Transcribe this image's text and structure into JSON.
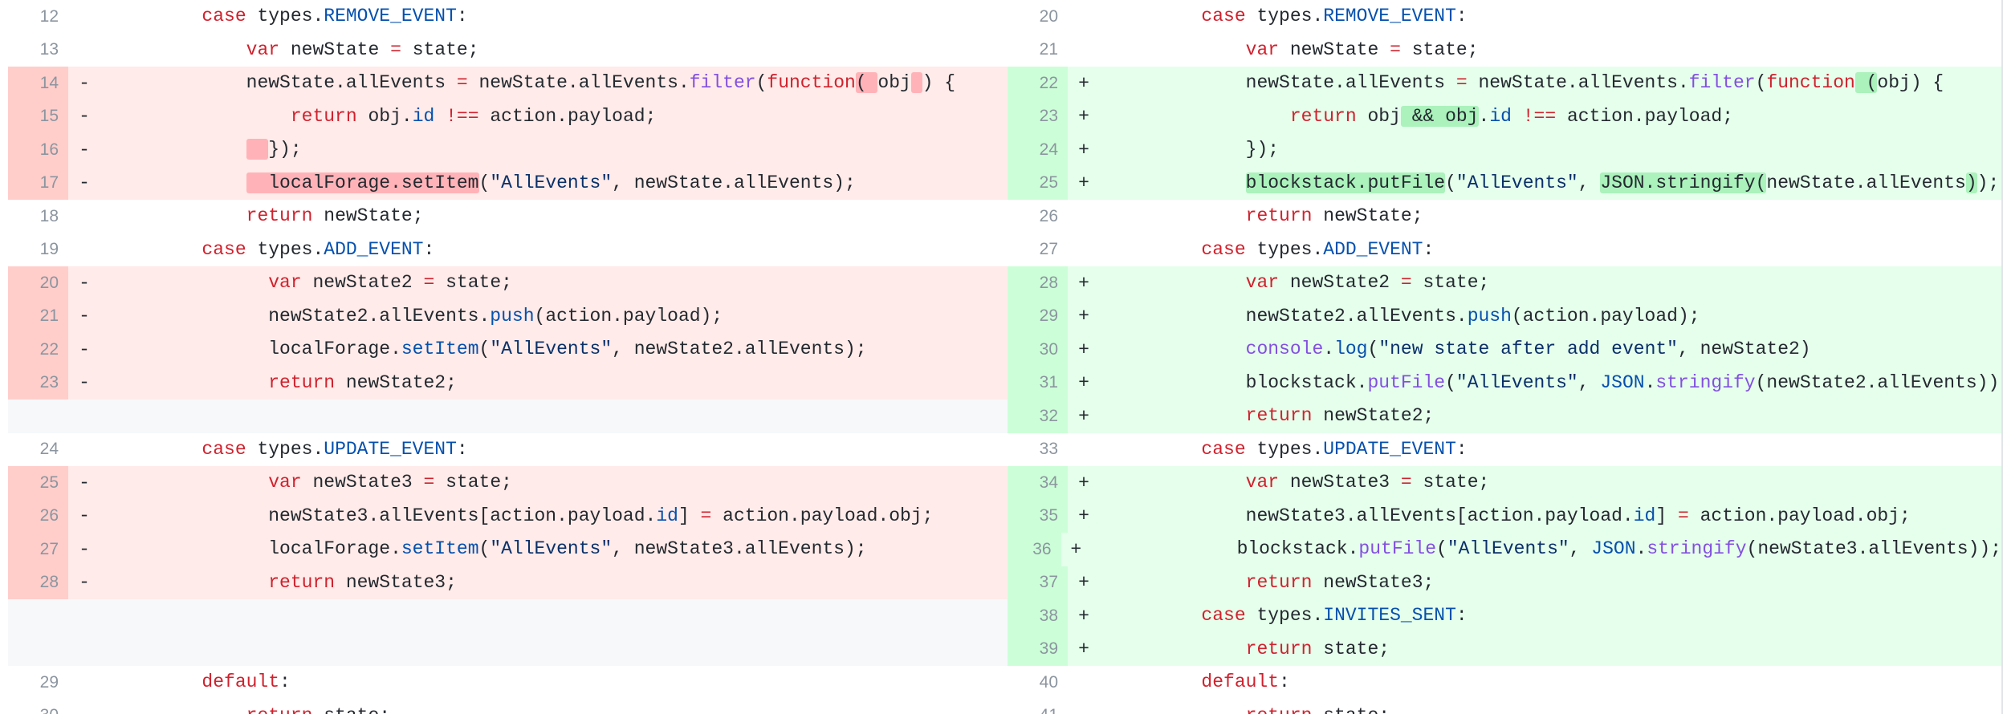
{
  "colors": {
    "keyword": "#cf222e",
    "constant": "#0550ae",
    "function": "#8250df",
    "string": "#0a3069",
    "deleted_bg": "#ffebe9",
    "deleted_gutter": "#ffcecb",
    "deleted_highlight": "#ffb3b8",
    "added_bg": "#e6ffec",
    "added_gutter": "#ccffd8",
    "added_highlight": "#abf2bc",
    "line_number": "#8c959f"
  },
  "left": [
    {
      "type": "ctx",
      "num": "12",
      "marker": "",
      "indent": 2,
      "tokens": [
        [
          "k",
          "case"
        ],
        [
          "p",
          " types."
        ],
        [
          "c",
          "REMOVE_EVENT"
        ],
        [
          "p",
          ":"
        ]
      ]
    },
    {
      "type": "ctx",
      "num": "13",
      "marker": "",
      "indent": 3,
      "tokens": [
        [
          "k",
          "var"
        ],
        [
          "p",
          " newState "
        ],
        [
          "k",
          "="
        ],
        [
          "p",
          " state;"
        ]
      ]
    },
    {
      "type": "del",
      "num": "14",
      "marker": "-",
      "indent": 3,
      "tokens": [
        [
          "p",
          "newState.allEvents "
        ],
        [
          "k",
          "="
        ],
        [
          "p",
          " newState.allEvents."
        ],
        [
          "f",
          "filter"
        ],
        [
          "p",
          "("
        ],
        [
          "k",
          "function"
        ],
        [
          "hl",
          "( "
        ],
        [
          "p",
          "obj"
        ],
        [
          "hl",
          " "
        ],
        [
          "p",
          ") {"
        ]
      ]
    },
    {
      "type": "del",
      "num": "15",
      "marker": "-",
      "indent": 4,
      "tokens": [
        [
          "k",
          "return"
        ],
        [
          "p",
          " obj."
        ],
        [
          "c",
          "id"
        ],
        [
          "p",
          " "
        ],
        [
          "k",
          "!=="
        ],
        [
          "p",
          " action.payload;"
        ]
      ]
    },
    {
      "type": "del",
      "num": "16",
      "marker": "-",
      "indent": 3,
      "tokens": [
        [
          "hl",
          "  "
        ],
        [
          "p",
          "});"
        ]
      ]
    },
    {
      "type": "del",
      "num": "17",
      "marker": "-",
      "indent": 3,
      "tokens": [
        [
          "hl",
          "  localForage.setItem"
        ],
        [
          "p",
          "("
        ],
        [
          "s",
          "\"AllEvents\""
        ],
        [
          "p",
          ", newState.allEvents);"
        ]
      ]
    },
    {
      "type": "ctx",
      "num": "18",
      "marker": "",
      "indent": 3,
      "tokens": [
        [
          "k",
          "return"
        ],
        [
          "p",
          " newState;"
        ]
      ]
    },
    {
      "type": "ctx",
      "num": "19",
      "marker": "",
      "indent": 2,
      "tokens": [
        [
          "k",
          "case"
        ],
        [
          "p",
          " types."
        ],
        [
          "c",
          "ADD_EVENT"
        ],
        [
          "p",
          ":"
        ]
      ]
    },
    {
      "type": "del",
      "num": "20",
      "marker": "-",
      "indent": 3,
      "tokens": [
        [
          "p",
          "  "
        ],
        [
          "k",
          "var"
        ],
        [
          "p",
          " newState2 "
        ],
        [
          "k",
          "="
        ],
        [
          "p",
          " state;"
        ]
      ]
    },
    {
      "type": "del",
      "num": "21",
      "marker": "-",
      "indent": 3,
      "tokens": [
        [
          "p",
          "  newState2.allEvents."
        ],
        [
          "c",
          "push"
        ],
        [
          "p",
          "(action.payload);"
        ]
      ]
    },
    {
      "type": "del",
      "num": "22",
      "marker": "-",
      "indent": 3,
      "tokens": [
        [
          "p",
          "  localForage."
        ],
        [
          "c",
          "setItem"
        ],
        [
          "p",
          "("
        ],
        [
          "s",
          "\"AllEvents\""
        ],
        [
          "p",
          ", newState2.allEvents);"
        ]
      ]
    },
    {
      "type": "del",
      "num": "23",
      "marker": "-",
      "indent": 3,
      "tokens": [
        [
          "p",
          "  "
        ],
        [
          "k",
          "return"
        ],
        [
          "p",
          " newState2;"
        ]
      ]
    },
    {
      "type": "empty",
      "num": "",
      "marker": "",
      "indent": 0,
      "tokens": []
    },
    {
      "type": "ctx",
      "num": "24",
      "marker": "",
      "indent": 2,
      "tokens": [
        [
          "k",
          "case"
        ],
        [
          "p",
          " types."
        ],
        [
          "c",
          "UPDATE_EVENT"
        ],
        [
          "p",
          ":"
        ]
      ]
    },
    {
      "type": "del",
      "num": "25",
      "marker": "-",
      "indent": 3,
      "tokens": [
        [
          "p",
          "  "
        ],
        [
          "k",
          "var"
        ],
        [
          "p",
          " newState3 "
        ],
        [
          "k",
          "="
        ],
        [
          "p",
          " state;"
        ]
      ]
    },
    {
      "type": "del",
      "num": "26",
      "marker": "-",
      "indent": 3,
      "tokens": [
        [
          "p",
          "  newState3.allEvents[action.payload."
        ],
        [
          "c",
          "id"
        ],
        [
          "p",
          "] "
        ],
        [
          "k",
          "="
        ],
        [
          "p",
          " action.payload.obj;"
        ]
      ]
    },
    {
      "type": "del",
      "num": "27",
      "marker": "-",
      "indent": 3,
      "tokens": [
        [
          "p",
          "  localForage."
        ],
        [
          "c",
          "setItem"
        ],
        [
          "p",
          "("
        ],
        [
          "s",
          "\"AllEvents\""
        ],
        [
          "p",
          ", newState3.allEvents);"
        ]
      ]
    },
    {
      "type": "del",
      "num": "28",
      "marker": "-",
      "indent": 3,
      "tokens": [
        [
          "p",
          "  "
        ],
        [
          "k",
          "return"
        ],
        [
          "p",
          " newState3;"
        ]
      ]
    },
    {
      "type": "empty",
      "num": "",
      "marker": "",
      "indent": 0,
      "tokens": []
    },
    {
      "type": "empty",
      "num": "",
      "marker": "",
      "indent": 0,
      "tokens": []
    },
    {
      "type": "ctx",
      "num": "29",
      "marker": "",
      "indent": 2,
      "tokens": [
        [
          "k",
          "default"
        ],
        [
          "p",
          ":"
        ]
      ]
    },
    {
      "type": "ctx",
      "num": "30",
      "marker": "",
      "indent": 3,
      "tokens": [
        [
          "k",
          "return"
        ],
        [
          "p",
          " state;"
        ]
      ]
    }
  ],
  "right": [
    {
      "type": "ctx",
      "num": "20",
      "marker": "",
      "indent": 2,
      "tokens": [
        [
          "k",
          "case"
        ],
        [
          "p",
          " types."
        ],
        [
          "c",
          "REMOVE_EVENT"
        ],
        [
          "p",
          ":"
        ]
      ]
    },
    {
      "type": "ctx",
      "num": "21",
      "marker": "",
      "indent": 3,
      "tokens": [
        [
          "k",
          "var"
        ],
        [
          "p",
          " newState "
        ],
        [
          "k",
          "="
        ],
        [
          "p",
          " state;"
        ]
      ]
    },
    {
      "type": "add",
      "num": "22",
      "marker": "+",
      "indent": 3,
      "tokens": [
        [
          "p",
          "newState.allEvents "
        ],
        [
          "k",
          "="
        ],
        [
          "p",
          " newState.allEvents."
        ],
        [
          "f",
          "filter"
        ],
        [
          "p",
          "("
        ],
        [
          "k",
          "function"
        ],
        [
          "hl",
          " ("
        ],
        [
          "p",
          "obj) {"
        ]
      ]
    },
    {
      "type": "add",
      "num": "23",
      "marker": "+",
      "indent": 4,
      "tokens": [
        [
          "k",
          "return"
        ],
        [
          "p",
          " obj"
        ],
        [
          "hl",
          " && obj"
        ],
        [
          "p",
          "."
        ],
        [
          "c",
          "id"
        ],
        [
          "p",
          " "
        ],
        [
          "k",
          "!=="
        ],
        [
          "p",
          " action.payload;"
        ]
      ]
    },
    {
      "type": "add",
      "num": "24",
      "marker": "+",
      "indent": 3,
      "tokens": [
        [
          "p",
          "});"
        ]
      ]
    },
    {
      "type": "add",
      "num": "25",
      "marker": "+",
      "indent": 3,
      "tokens": [
        [
          "hl",
          "blockstack.putFile"
        ],
        [
          "p",
          "("
        ],
        [
          "s",
          "\"AllEvents\""
        ],
        [
          "p",
          ", "
        ],
        [
          "hl",
          "JSON.stringify("
        ],
        [
          "p",
          "newState.allEvents"
        ],
        [
          "hl",
          ")"
        ],
        [
          "p",
          ");"
        ]
      ]
    },
    {
      "type": "ctx",
      "num": "26",
      "marker": "",
      "indent": 3,
      "tokens": [
        [
          "k",
          "return"
        ],
        [
          "p",
          " newState;"
        ]
      ]
    },
    {
      "type": "ctx",
      "num": "27",
      "marker": "",
      "indent": 2,
      "tokens": [
        [
          "k",
          "case"
        ],
        [
          "p",
          " types."
        ],
        [
          "c",
          "ADD_EVENT"
        ],
        [
          "p",
          ":"
        ]
      ]
    },
    {
      "type": "add",
      "num": "28",
      "marker": "+",
      "indent": 3,
      "tokens": [
        [
          "k",
          "var"
        ],
        [
          "p",
          " newState2 "
        ],
        [
          "k",
          "="
        ],
        [
          "p",
          " state;"
        ]
      ]
    },
    {
      "type": "add",
      "num": "29",
      "marker": "+",
      "indent": 3,
      "tokens": [
        [
          "p",
          "newState2.allEvents."
        ],
        [
          "c",
          "push"
        ],
        [
          "p",
          "(action.payload);"
        ]
      ]
    },
    {
      "type": "add",
      "num": "30",
      "marker": "+",
      "indent": 3,
      "tokens": [
        [
          "f",
          "console"
        ],
        [
          "p",
          "."
        ],
        [
          "c",
          "log"
        ],
        [
          "p",
          "("
        ],
        [
          "s",
          "\"new state after add event\""
        ],
        [
          "p",
          ", newState2)"
        ]
      ]
    },
    {
      "type": "add",
      "num": "31",
      "marker": "+",
      "indent": 3,
      "tokens": [
        [
          "p",
          "blockstack."
        ],
        [
          "f",
          "putFile"
        ],
        [
          "p",
          "("
        ],
        [
          "s",
          "\"AllEvents\""
        ],
        [
          "p",
          ", "
        ],
        [
          "c",
          "JSON"
        ],
        [
          "p",
          "."
        ],
        [
          "f",
          "stringify"
        ],
        [
          "p",
          "(newState2.allEvents))"
        ]
      ]
    },
    {
      "type": "add",
      "num": "32",
      "marker": "+",
      "indent": 3,
      "tokens": [
        [
          "k",
          "return"
        ],
        [
          "p",
          " newState2;"
        ]
      ]
    },
    {
      "type": "ctx",
      "num": "33",
      "marker": "",
      "indent": 2,
      "tokens": [
        [
          "k",
          "case"
        ],
        [
          "p",
          " types."
        ],
        [
          "c",
          "UPDATE_EVENT"
        ],
        [
          "p",
          ":"
        ]
      ]
    },
    {
      "type": "add",
      "num": "34",
      "marker": "+",
      "indent": 3,
      "tokens": [
        [
          "k",
          "var"
        ],
        [
          "p",
          " newState3 "
        ],
        [
          "k",
          "="
        ],
        [
          "p",
          " state;"
        ]
      ]
    },
    {
      "type": "add",
      "num": "35",
      "marker": "+",
      "indent": 3,
      "tokens": [
        [
          "p",
          "newState3.allEvents[action.payload."
        ],
        [
          "c",
          "id"
        ],
        [
          "p",
          "] "
        ],
        [
          "k",
          "="
        ],
        [
          "p",
          " action.payload.obj;"
        ]
      ]
    },
    {
      "type": "add",
      "num": "36",
      "marker": "+",
      "indent": 3,
      "tokens": [
        [
          "p",
          "blockstack."
        ],
        [
          "f",
          "putFile"
        ],
        [
          "p",
          "("
        ],
        [
          "s",
          "\"AllEvents\""
        ],
        [
          "p",
          ", "
        ],
        [
          "c",
          "JSON"
        ],
        [
          "p",
          "."
        ],
        [
          "f",
          "stringify"
        ],
        [
          "p",
          "(newState3.allEvents));"
        ]
      ]
    },
    {
      "type": "add",
      "num": "37",
      "marker": "+",
      "indent": 3,
      "tokens": [
        [
          "k",
          "return"
        ],
        [
          "p",
          " newState3;"
        ]
      ]
    },
    {
      "type": "add",
      "num": "38",
      "marker": "+",
      "indent": 2,
      "tokens": [
        [
          "k",
          "case"
        ],
        [
          "p",
          " types."
        ],
        [
          "c",
          "INVITES_SENT"
        ],
        [
          "p",
          ":"
        ]
      ]
    },
    {
      "type": "add",
      "num": "39",
      "marker": "+",
      "indent": 3,
      "tokens": [
        [
          "k",
          "return"
        ],
        [
          "p",
          " state;"
        ]
      ]
    },
    {
      "type": "ctx",
      "num": "40",
      "marker": "",
      "indent": 2,
      "tokens": [
        [
          "k",
          "default"
        ],
        [
          "p",
          ":"
        ]
      ]
    },
    {
      "type": "ctx",
      "num": "41",
      "marker": "",
      "indent": 3,
      "tokens": [
        [
          "k",
          "return"
        ],
        [
          "p",
          " state;"
        ]
      ]
    }
  ]
}
